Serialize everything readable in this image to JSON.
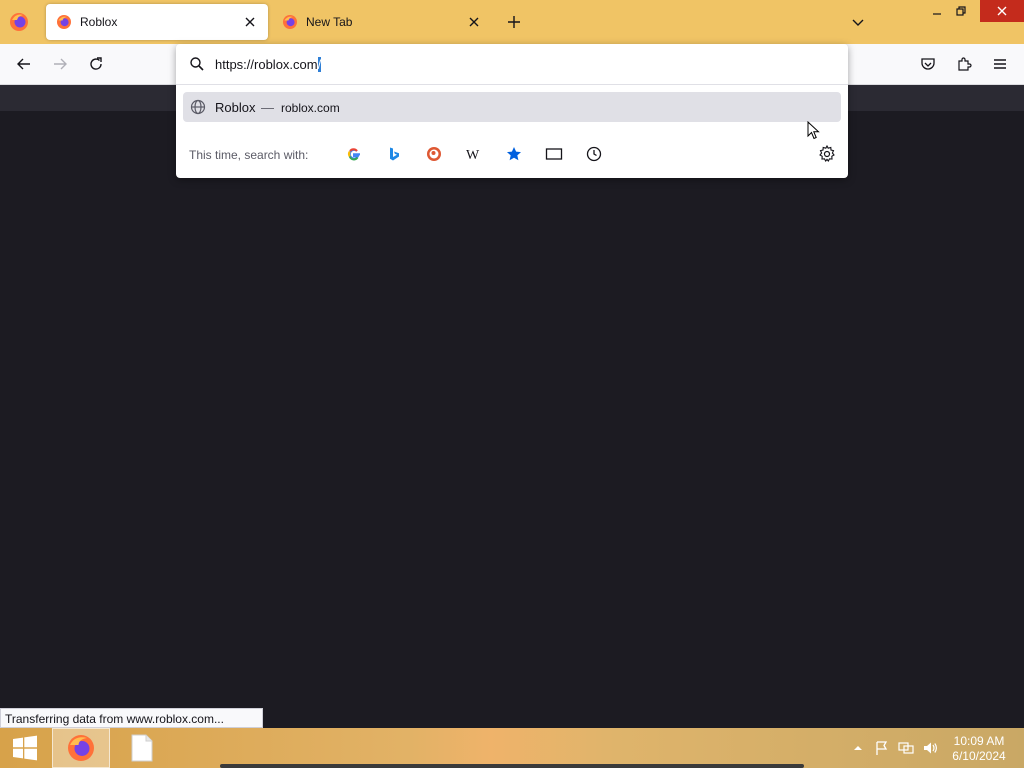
{
  "tabs": [
    {
      "title": "Roblox",
      "active": true,
      "favicon": "firefox-icon"
    },
    {
      "title": "New Tab",
      "active": false,
      "favicon": "firefox-icon"
    }
  ],
  "urlbar": {
    "text_before_selection": "https://roblox.com",
    "selected_text": "/"
  },
  "suggestion": {
    "title": "Roblox",
    "separator": "—",
    "url": "roblox.com",
    "icon": "globe-icon"
  },
  "search_with": {
    "label": "This time, search with:",
    "engines": [
      "google-icon",
      "bing-icon",
      "duckduckgo-icon",
      "wikipedia-icon",
      "bookmarks-star-icon",
      "tabs-icon",
      "history-clock-icon"
    ]
  },
  "status_text": "Transferring data from www.roblox.com...",
  "clock": {
    "time": "10:09 AM",
    "date": "6/10/2024"
  },
  "colors": {
    "tabstrip": "#f0c465",
    "page_background": "#1c1b22",
    "close_button": "#c42b1c",
    "selection": "#2f7fd6"
  }
}
